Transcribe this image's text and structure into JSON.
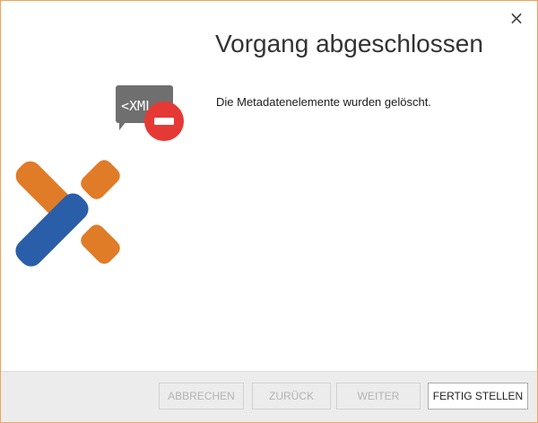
{
  "dialog": {
    "title": "Vorgang abgeschlossen",
    "message": "Die Metadatenelemente wurden gelöscht.",
    "close_glyph": "×",
    "logo_tag_text": "<XML",
    "icon": "xml-delete-badge-icon"
  },
  "footer": {
    "cancel_label": "ABBRECHEN",
    "back_label": "ZURÜCK",
    "next_label": "WEITER",
    "finish_label": "FERTIG STELLEN"
  },
  "colors": {
    "accent_orange": "#e07b28",
    "accent_blue": "#2a5ea8",
    "danger_red": "#e53935",
    "bubble_gray": "#6f6f6f",
    "window_border": "#f0a35a"
  }
}
